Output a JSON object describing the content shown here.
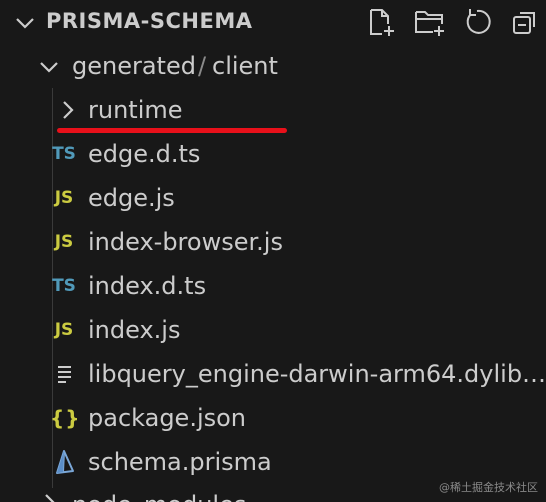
{
  "explorer": {
    "title": "PRISMA-SCHEMA",
    "toolbar": [
      "new-file-icon",
      "new-folder-icon",
      "refresh-icon",
      "collapse-all-icon"
    ]
  },
  "tree": {
    "folder_parts": [
      "generated",
      "client"
    ],
    "folder_separator": "/",
    "items": [
      {
        "label": "runtime",
        "kind": "folder",
        "icon": "chevron-right-icon"
      },
      {
        "label": "edge.d.ts",
        "kind": "ts",
        "icon_text": "TS"
      },
      {
        "label": "edge.js",
        "kind": "js",
        "icon_text": "JS"
      },
      {
        "label": "index-browser.js",
        "kind": "js",
        "icon_text": "JS"
      },
      {
        "label": "index.d.ts",
        "kind": "ts",
        "icon_text": "TS"
      },
      {
        "label": "index.js",
        "kind": "js",
        "icon_text": "JS"
      },
      {
        "label": "libquery_engine-darwin-arm64.dylib…",
        "kind": "text",
        "icon": "lines-icon"
      },
      {
        "label": "package.json",
        "kind": "json",
        "icon_text": "{}"
      },
      {
        "label": "schema.prisma",
        "kind": "prisma",
        "icon": "prisma-icon"
      }
    ],
    "partial_last_item": "node_modules"
  },
  "colors": {
    "ts": "#519aba",
    "js": "#cbcb41",
    "highlight": "#e8101a",
    "background": "#181818"
  },
  "watermark": "@稀土掘金技术社区"
}
